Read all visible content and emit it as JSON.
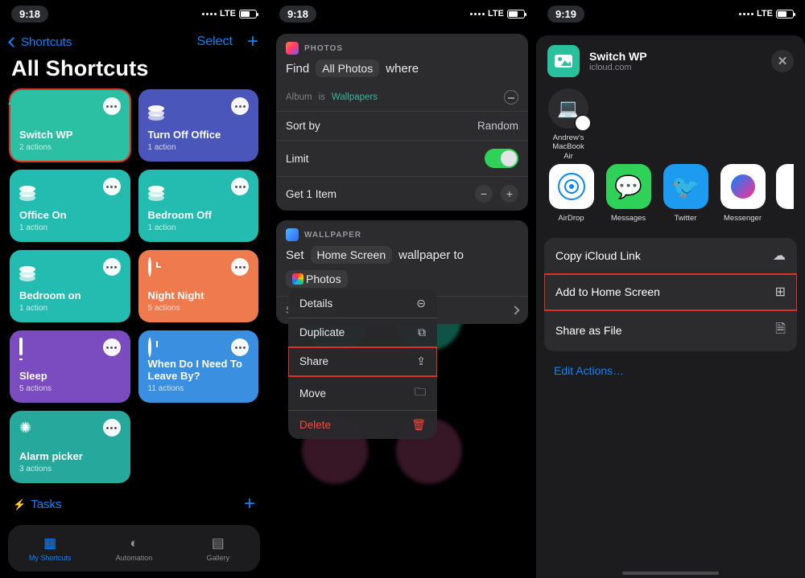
{
  "status": {
    "time_a": "9:18",
    "time_b": "9:18",
    "time_c": "9:19",
    "net": "LTE"
  },
  "screen1": {
    "back": "Shortcuts",
    "select": "Select",
    "title": "All Shortcuts",
    "folder": "Tasks",
    "tabs": {
      "my": "My Shortcuts",
      "automation": "Automation",
      "gallery": "Gallery"
    },
    "cards": [
      {
        "name": "Switch WP",
        "sub": "2 actions",
        "color": "c-teal",
        "icon": "image",
        "hl": true
      },
      {
        "name": "Turn Off Office",
        "sub": "1 action",
        "color": "c-indigo",
        "icon": "stack",
        "hl": false
      },
      {
        "name": "Office On",
        "sub": "1 action",
        "color": "c-teal2",
        "icon": "stack",
        "hl": false
      },
      {
        "name": "Bedroom Off",
        "sub": "1 action",
        "color": "c-teal3",
        "icon": "stack",
        "hl": false
      },
      {
        "name": "Bedroom on",
        "sub": "1 action",
        "color": "c-teal4",
        "icon": "stack",
        "hl": false
      },
      {
        "name": "Night Night",
        "sub": "5 actions",
        "color": "c-orange",
        "icon": "alarm",
        "hl": false
      },
      {
        "name": "Sleep",
        "sub": "5 actions",
        "color": "c-purple",
        "icon": "bed",
        "hl": false
      },
      {
        "name": "When Do I Need To Leave By?",
        "sub": "11 actions",
        "color": "c-sky",
        "icon": "clock",
        "hl": false
      },
      {
        "name": "Alarm picker",
        "sub": "3 actions",
        "color": "c-teal5",
        "icon": "spark",
        "hl": false
      }
    ]
  },
  "screen2": {
    "photos": {
      "label": "PHOTOS",
      "find": "Find",
      "allphotos": "All Photos",
      "where": "where",
      "album_label": "Album",
      "is": "is",
      "album_value": "Wallpapers",
      "sortby_label": "Sort by",
      "sortby_value": "Random",
      "limit_label": "Limit",
      "getitem": "Get 1 Item"
    },
    "wallpaper": {
      "label": "WALLPAPER",
      "set": "Set",
      "home": "Home Screen",
      "wallpaper_to": "wallpaper to",
      "photos": "Photos",
      "showmore": "Show More"
    },
    "ctx": {
      "details": "Details",
      "duplicate": "Duplicate",
      "share": "Share",
      "move": "Move",
      "delete": "Delete"
    }
  },
  "screen3": {
    "title": "Switch WP",
    "subtitle": "icloud.com",
    "device": "Andrew's MacBook Air",
    "apps": {
      "airdrop": "AirDrop",
      "messages": "Messages",
      "twitter": "Twitter",
      "messenger": "Messenger"
    },
    "actions": {
      "copy": "Copy iCloud Link",
      "addhome": "Add to Home Screen",
      "sharefile": "Share as File"
    },
    "edit": "Edit Actions…"
  }
}
